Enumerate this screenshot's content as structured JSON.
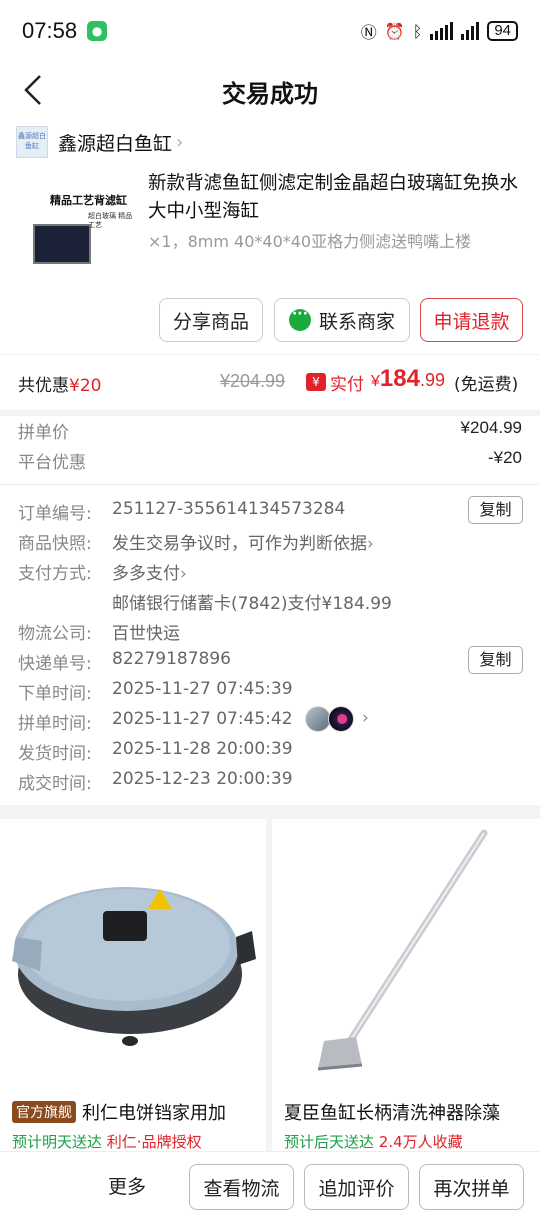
{
  "status": {
    "time": "07:58",
    "battery": "94"
  },
  "nav": {
    "title": "交易成功"
  },
  "shop": {
    "name": "鑫源超白鱼缸",
    "logo_text": "鑫源超白鱼缸"
  },
  "product": {
    "title": "新款背滤鱼缸侧滤定制金晶超白玻璃缸免换水大中小型海缸",
    "spec": "×1，8mm 40*40*40亚格力侧滤送鸭嘴上楼",
    "image_caption": "精品工艺背滤缸",
    "image_sub": "超白玻璃 精品工艺"
  },
  "actions": {
    "share": "分享商品",
    "contact": "联系商家",
    "refund": "申请退款"
  },
  "price": {
    "discount_label": "共优惠",
    "discount_value": "¥20",
    "original": "¥204.99",
    "paid_label": "实付",
    "paid_currency": "¥",
    "paid_int": "184",
    "paid_dec": ".99",
    "shipping": "(免运费)"
  },
  "breakdown": [
    {
      "key": "拼单价",
      "value": "¥204.99"
    },
    {
      "key": "平台优惠",
      "value": "-¥20"
    }
  ],
  "order": {
    "id_label": "订单编号:",
    "id": "251127-355614134573284",
    "copy": "复制",
    "snapshot_label": "商品快照:",
    "snapshot": "发生交易争议时，可作为判断依据",
    "payment_label": "支付方式:",
    "payment": "多多支付",
    "payment_detail": "邮储银行储蓄卡(7842)支付¥184.99",
    "logistics_label": "物流公司:",
    "logistics": "百世快运",
    "tracking_label": "快递单号:",
    "tracking": "82279187896",
    "placed_label": "下单时间:",
    "placed": "2025-11-27 07:45:39",
    "grouped_label": "拼单时间:",
    "grouped": "2025-11-27 07:45:42",
    "shipped_label": "发货时间:",
    "shipped": "2025-11-28 20:00:39",
    "completed_label": "成交时间:",
    "completed": "2025-12-23 20:00:39"
  },
  "recommend": [
    {
      "tag": "官方旗舰",
      "title": "利仁电饼铛家用加",
      "delivery": "预计明天送达",
      "extra": "利仁·品牌授权",
      "brand": "利仁"
    },
    {
      "title": "夏臣鱼缸长柄清洗神器除藻",
      "delivery": "预计后天送达",
      "extra": "2.4万人收藏"
    }
  ],
  "bottom": {
    "more": "更多",
    "logistics": "查看物流",
    "review": "追加评价",
    "reorder": "再次拼单"
  },
  "colors": {
    "accent": "#e0222a",
    "green": "#1aa04a"
  }
}
